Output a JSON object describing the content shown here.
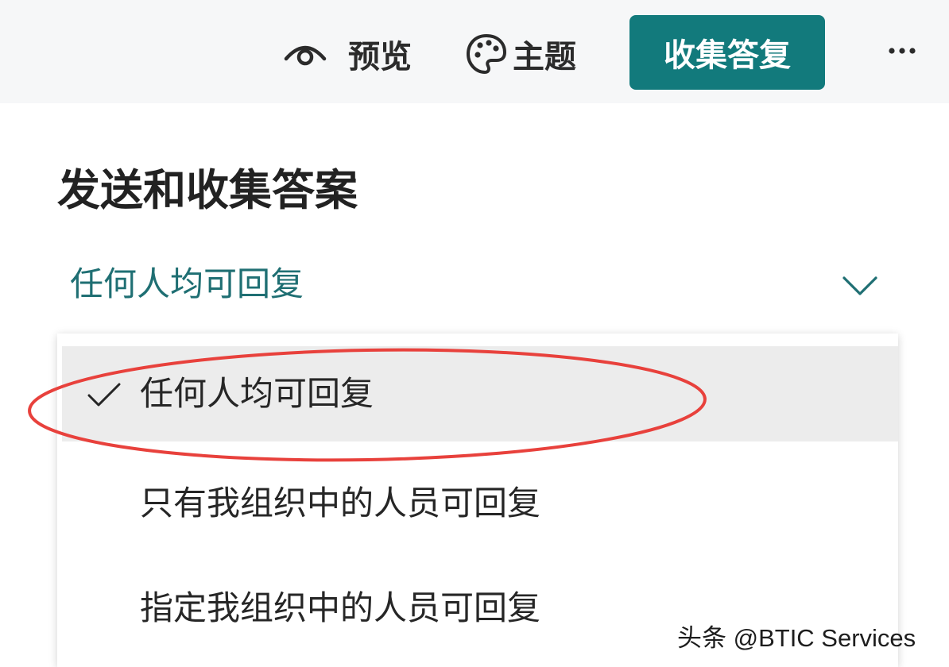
{
  "toolbar": {
    "preview_label": "预览",
    "preview_icon": "eye-icon",
    "theme_label": "主题",
    "theme_icon": "palette-icon",
    "collect_button_label": "收集答复",
    "more_icon": "more-horizontal-icon",
    "accent_color": "#127a7c"
  },
  "panel": {
    "title": "发送和收集答案",
    "selected_value": "任何人均可回复",
    "chevron_icon": "chevron-down-icon"
  },
  "dropdown": {
    "options": [
      {
        "label": "任何人均可回复",
        "selected": true
      },
      {
        "label": "只有我组织中的人员可回复",
        "selected": false
      },
      {
        "label": "指定我组织中的人员可回复",
        "selected": false
      }
    ],
    "check_icon": "checkmark-icon",
    "highlight_color": "#e8413c"
  },
  "watermark": {
    "text": "头条 @BTIC Services"
  }
}
